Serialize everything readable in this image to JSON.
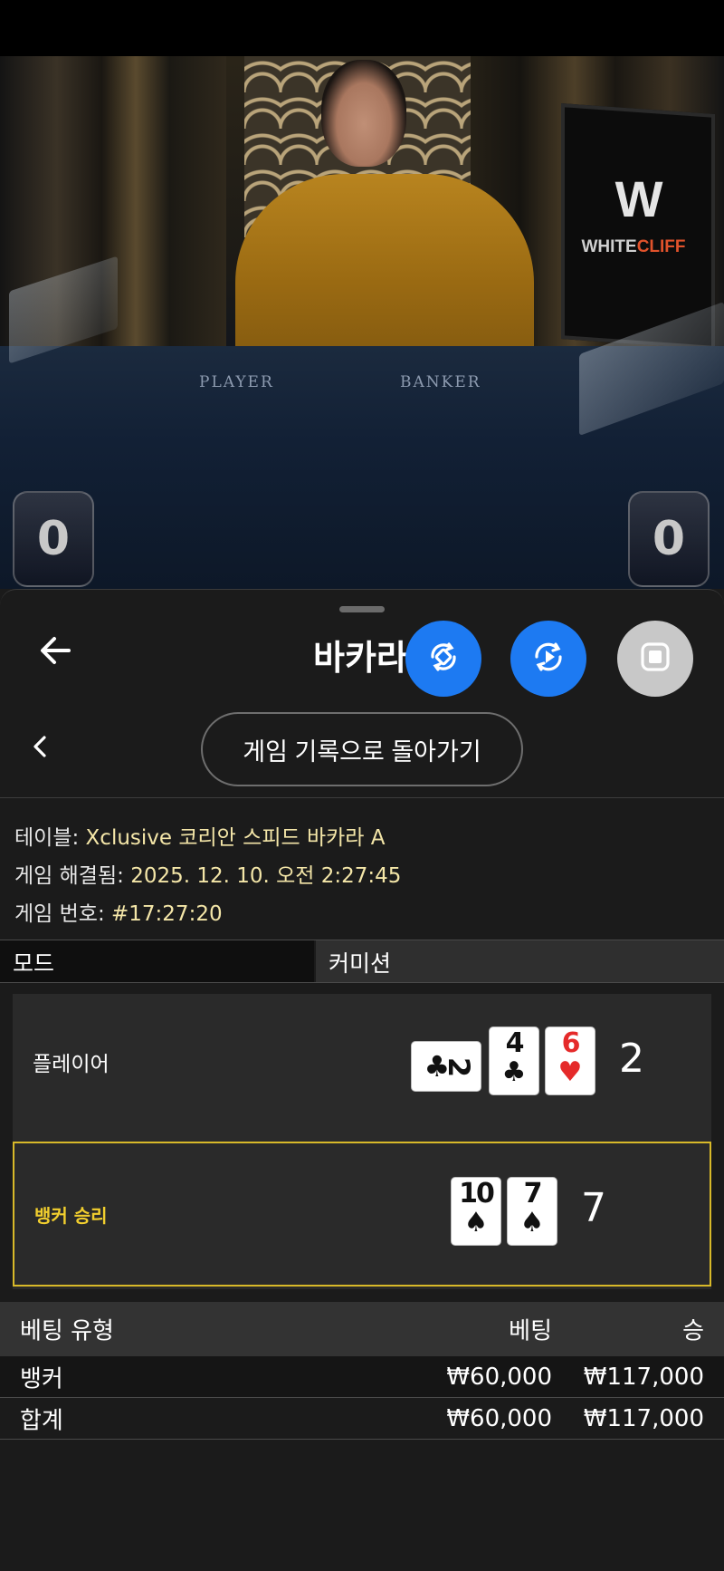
{
  "video": {
    "table_labels": {
      "player": "PLAYER",
      "banker": "BANKER"
    },
    "monitor_brand": {
      "white": "WHITE",
      "accent": "CLIFF"
    },
    "player_score": "0",
    "banker_score": "0"
  },
  "sheet": {
    "title": "바카라",
    "history_button": "게임 기록으로 돌아가기",
    "info": {
      "table_label": "테이블:",
      "table_value": "Xclusive 코리안 스피드 바카라 A",
      "resolved_label": "게임 해결됨:",
      "resolved_value": "2025. 12. 10. 오전 2:27:45",
      "game_no_label": "게임 번호:",
      "game_no_value": "#17:27:20"
    },
    "mode": {
      "mode_label": "모드",
      "commission_label": "커미션"
    },
    "result": {
      "player": {
        "label": "플레이어",
        "total": "2",
        "cards": [
          {
            "rank": "2",
            "suit": "♣",
            "color": "#111111",
            "orientation": "sideways"
          },
          {
            "rank": "4",
            "suit": "♣",
            "color": "#111111"
          },
          {
            "rank": "6",
            "suit": "♥",
            "color": "#e52a2a"
          }
        ]
      },
      "banker": {
        "label": "뱅커 승리",
        "total": "7",
        "cards": [
          {
            "rank": "10",
            "suit": "♠",
            "color": "#111111"
          },
          {
            "rank": "7",
            "suit": "♠",
            "color": "#111111"
          }
        ]
      }
    },
    "bets": {
      "headers": {
        "type": "베팅 유형",
        "bet": "베팅",
        "win": "승"
      },
      "rows": [
        {
          "type": "뱅커",
          "bet": "₩60,000",
          "win": "₩117,000"
        }
      ],
      "total": {
        "type": "합계",
        "bet": "₩60,000",
        "win": "₩117,000"
      }
    }
  },
  "colors": {
    "accent_blue": "#1d7af2",
    "winner_gold": "#d8b929",
    "value_text": "#f4e6a8"
  }
}
